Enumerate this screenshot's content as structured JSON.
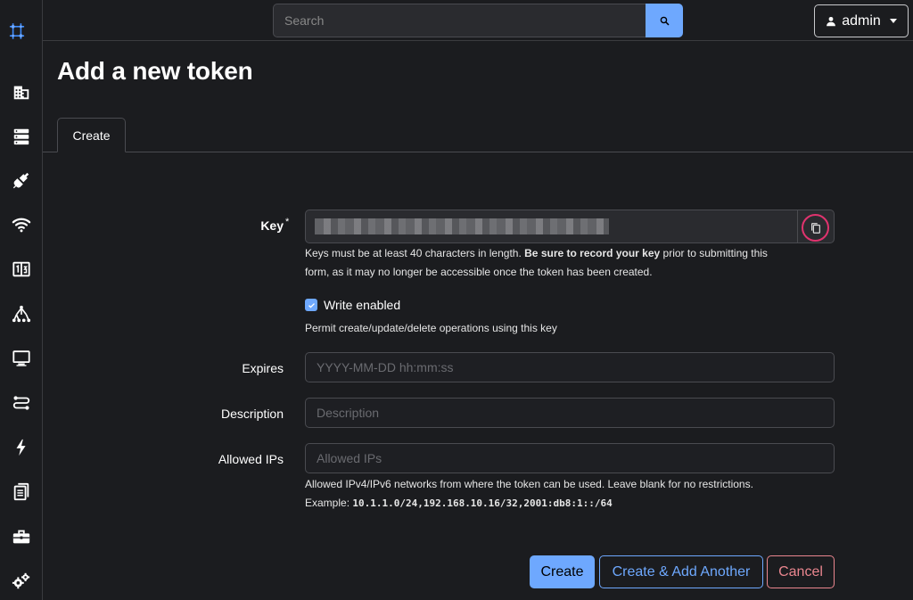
{
  "search": {
    "placeholder": "Search"
  },
  "user": {
    "name": "admin"
  },
  "page": {
    "title": "Add a new token"
  },
  "tabs": [
    {
      "label": "Create"
    }
  ],
  "form": {
    "key": {
      "label": "Key",
      "required_mark": "*",
      "help_part1": "Keys must be at least 40 characters in length. ",
      "help_bold": "Be sure to record your key",
      "help_part2": " prior to submitting this",
      "help_line2": "form, as it may no longer be accessible once the token has been created."
    },
    "write_enabled": {
      "label": "Write enabled",
      "checked": true,
      "help": "Permit create/update/delete operations using this key"
    },
    "expires": {
      "label": "Expires",
      "placeholder": "YYYY-MM-DD hh:mm:ss"
    },
    "description": {
      "label": "Description",
      "placeholder": "Description"
    },
    "allowed_ips": {
      "label": "Allowed IPs",
      "placeholder": "Allowed IPs",
      "help": "Allowed IPv4/IPv6 networks from where the token can be used. Leave blank for no restrictions.",
      "example_label": "Example: ",
      "example_value": "10.1.1.0/24,192.168.10.16/32,2001:db8:1::/64"
    }
  },
  "buttons": {
    "create": "Create",
    "create_another": "Create & Add Another",
    "cancel": "Cancel"
  },
  "colors": {
    "accent": "#6ea8fe",
    "danger": "#ea868f",
    "highlight": "#e0336e"
  }
}
